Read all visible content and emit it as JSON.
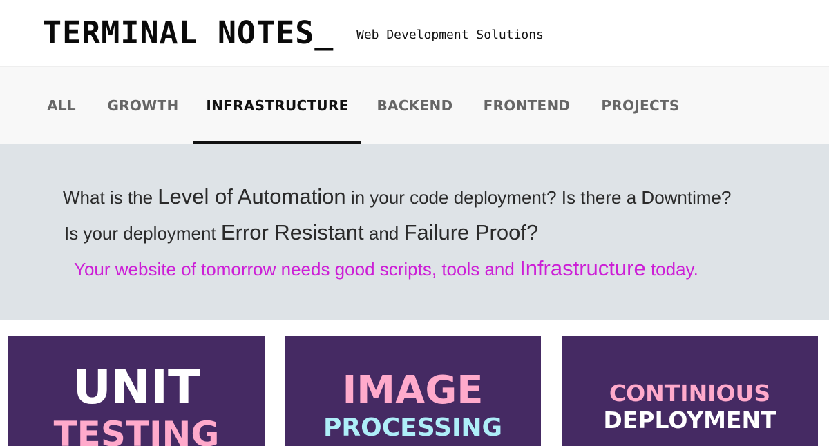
{
  "header": {
    "title": "TERMINAL NOTES_",
    "tagline": "Web Development Solutions"
  },
  "nav": {
    "items": [
      {
        "label": "ALL",
        "active": false
      },
      {
        "label": "GROWTH",
        "active": false
      },
      {
        "label": "INFRASTRUCTURE",
        "active": true
      },
      {
        "label": "BACKEND",
        "active": false
      },
      {
        "label": "FRONTEND",
        "active": false
      },
      {
        "label": "PROJECTS",
        "active": false
      }
    ]
  },
  "hero": {
    "line1": {
      "a": "What is the",
      "b": "Level of Automation",
      "c": "in your code deployment? Is there a Downtime?"
    },
    "line2": {
      "a": "Is your deployment",
      "b": "Error Resistant",
      "c": "and",
      "d": "Failure Proof",
      "e": "?"
    },
    "line3": {
      "a": "Your website of tomorrow needs good scripts, tools and",
      "b": "Infrastructure",
      "c": "today."
    },
    "accent_color": "#cc1fd6"
  },
  "cards": [
    {
      "word1": "UNIT",
      "word2": "TESTING",
      "word1_color": "#ffffff",
      "word2_color": "#ffaacb"
    },
    {
      "word1": "IMAGE",
      "word2": "PROCESSING",
      "word1_color": "#ffaacb",
      "word2_color": "#aeeef8"
    },
    {
      "word1": "CONTINIOUS",
      "word2": "DEPLOYMENT",
      "word1_color": "#ffaacb",
      "word2_color": "#ffffff"
    }
  ],
  "colors": {
    "card_bg": "#452a63",
    "nav_bg": "#f8f8f8",
    "hero_bg": "#dee3e7"
  }
}
